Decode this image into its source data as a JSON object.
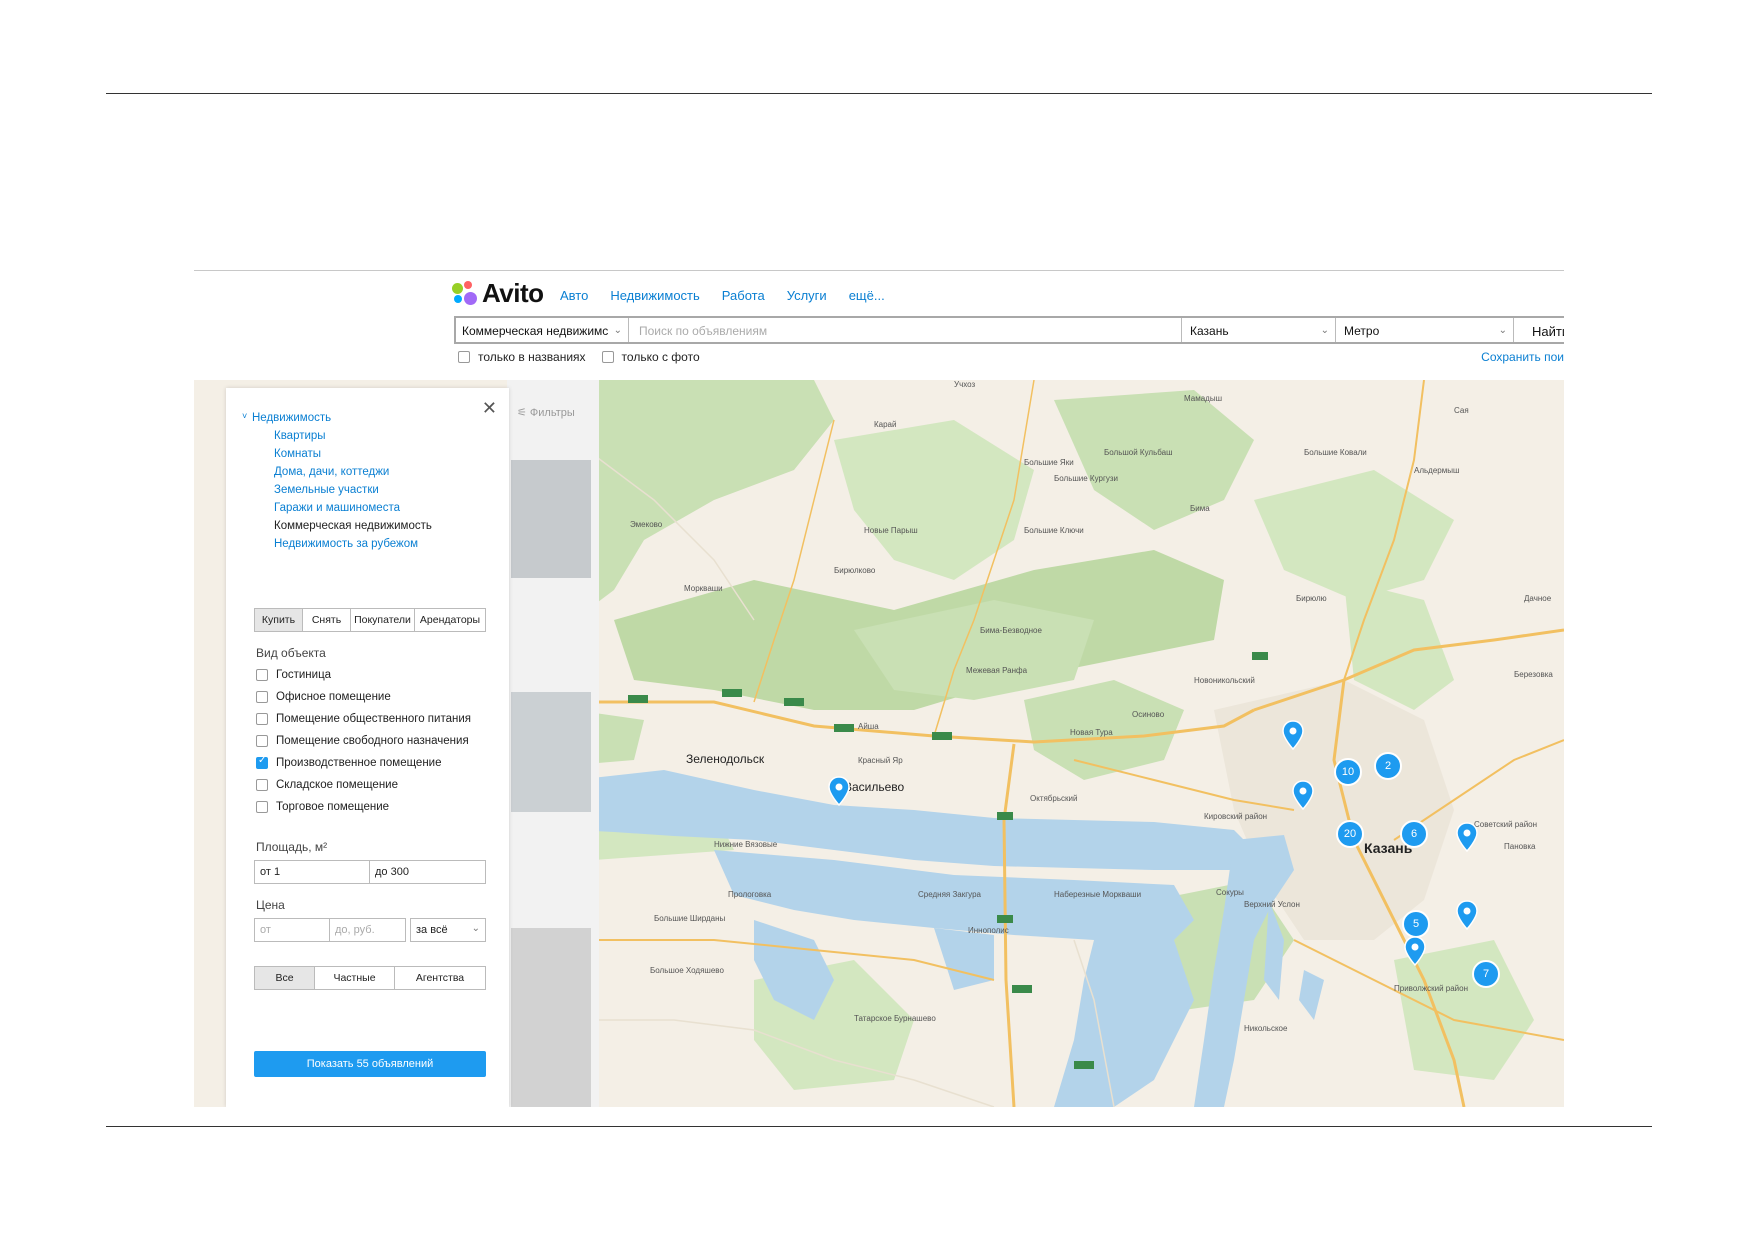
{
  "header": {
    "logo_text": "Avito",
    "nav": [
      "Авто",
      "Недвижимость",
      "Работа",
      "Услуги",
      "ещё..."
    ]
  },
  "search": {
    "category": "Коммерческая недвижимс",
    "placeholder": "Поиск по объявлениям",
    "city": "Казань",
    "metro": "Метро",
    "button": "Найти",
    "only_titles": "только в названиях",
    "only_photo": "только с фото",
    "save_search": "Сохранить пои"
  },
  "filters": {
    "toggle_label": "Фильтры",
    "tree": {
      "root": "Недвижимость",
      "items": [
        "Квартиры",
        "Комнаты",
        "Дома, дачи, коттеджи",
        "Земельные участки",
        "Гаражи и машиноместа",
        "Коммерческая недвижимость",
        "Недвижимость за рубежом"
      ],
      "current_index": 5
    },
    "deal_tabs": [
      "Купить",
      "Снять",
      "Покупатели",
      "Арендаторы"
    ],
    "deal_selected": 0,
    "object_type_label": "Вид объекта",
    "object_types": [
      {
        "label": "Гостиница",
        "checked": false
      },
      {
        "label": "Офисное помещение",
        "checked": false
      },
      {
        "label": "Помещение общественного питания",
        "checked": false
      },
      {
        "label": "Помещение свободного назначения",
        "checked": false
      },
      {
        "label": "Производственное помещение",
        "checked": true
      },
      {
        "label": "Складское помещение",
        "checked": false
      },
      {
        "label": "Торговое помещение",
        "checked": false
      }
    ],
    "area_label": "Площадь, м²",
    "area_from": "от 1",
    "area_to": "до 300",
    "price_label": "Цена",
    "price_from_placeholder": "от",
    "price_to_placeholder": "до, руб.",
    "price_unit": "за всё",
    "seller_tabs": [
      "Все",
      "Частные",
      "Агентства"
    ],
    "seller_selected": 0,
    "show_button": "Показать 55 объявлений"
  },
  "map": {
    "city_label": "Казань",
    "towns": [
      {
        "name": "Зеленодольск"
      },
      {
        "name": "Васильево"
      },
      {
        "name": "Верхний Услон"
      },
      {
        "name": "Нижние Вязовые"
      }
    ],
    "villages": [
      "Учхоз",
      "Мамадыш",
      "Сая",
      "Карай",
      "Большие Яки",
      "Большой Кульбаш",
      "Большие Ковали",
      "Большие Кургузи",
      "Альдермыш",
      "Эмеково",
      "Новые Парыш",
      "Большие Ключи",
      "Бима",
      "Бирюлково",
      "Моркваши",
      "Бирюлю",
      "Бима-Безводное",
      "Дачное",
      "Межевая Ранфа",
      "Новоникольский",
      "Березовка",
      "Осиново",
      "Новая Тура",
      "Айша",
      "Красный Яр",
      "Октябрьский",
      "Кировский район",
      "Советский район",
      "Пановка",
      "Прологовка",
      "Средняя Закгура",
      "Наберезные Моркваши",
      "Большие Ширданы",
      "Иннополис",
      "Большое Ходяшево",
      "Приволжский район",
      "Татарское Бурнашево",
      "Никольское",
      "Сокуры"
    ],
    "clusters": [
      {
        "count": "10"
      },
      {
        "count": "2"
      },
      {
        "count": "20"
      },
      {
        "count": "6"
      },
      {
        "count": "5"
      },
      {
        "count": "7"
      }
    ],
    "route_labels": [
      "А-295",
      "А-295",
      "М-7",
      "М-7",
      "А-295",
      "М-7",
      "Р-241",
      "Р-241"
    ]
  },
  "colors": {
    "accent": "#0a7fd2",
    "button": "#1e9bf0",
    "map_land": "#f4efe6",
    "map_forest": "#c9e0b4",
    "map_water": "#b3d3ea",
    "road": "#f2c061"
  }
}
